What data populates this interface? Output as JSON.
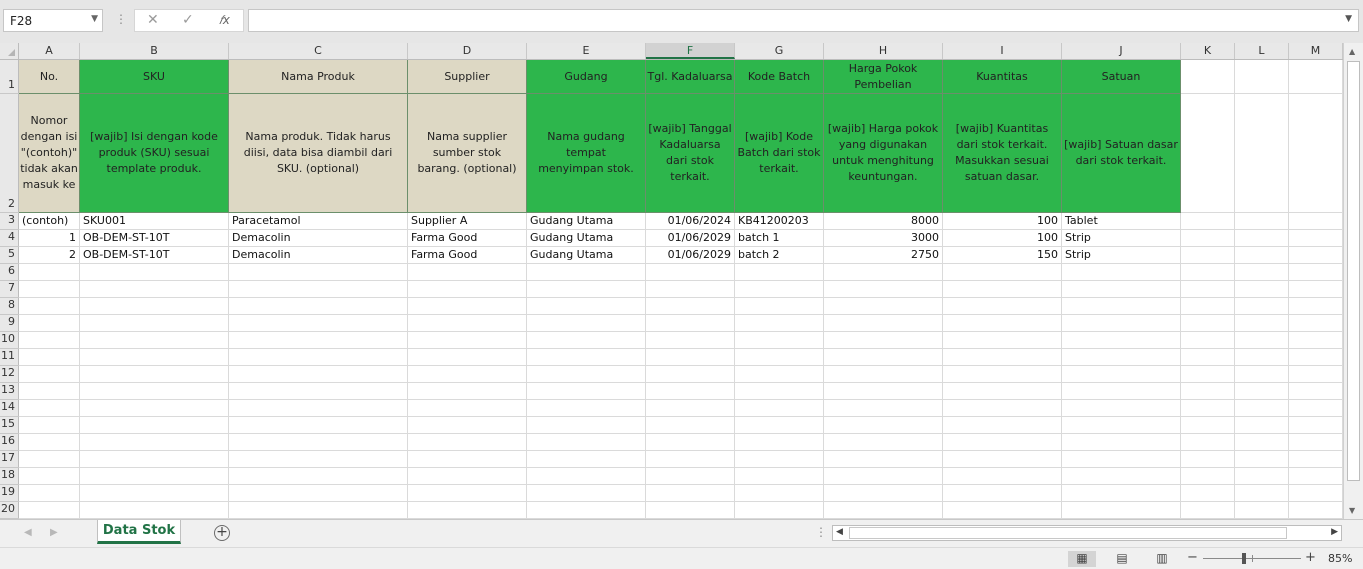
{
  "formula_bar": {
    "name_box": "F28",
    "sep": "⋮",
    "cancel_glyph": "✕",
    "enter_glyph": "✓",
    "fx_glyph": "𝑓x",
    "formula": ""
  },
  "columns": [
    "A",
    "B",
    "C",
    "D",
    "E",
    "F",
    "G",
    "H",
    "I",
    "J",
    "K",
    "L",
    "M"
  ],
  "selected_column": "F",
  "rows": [
    "1",
    "2",
    "3",
    "4",
    "5",
    "6",
    "7",
    "8",
    "9",
    "10",
    "11",
    "12",
    "13",
    "14",
    "15",
    "16",
    "17",
    "18",
    "19",
    "20"
  ],
  "header_row": {
    "no": "No.",
    "sku": "SKU",
    "nama_produk": "Nama Produk",
    "supplier": "Supplier",
    "gudang": "Gudang",
    "tgl_kadaluarsa": "Tgl. Kadaluarsa",
    "kode_batch": "Kode Batch",
    "harga_pokok": "Harga Pokok Pembelian",
    "kuantitas": "Kuantitas",
    "satuan": "Satuan"
  },
  "description_row": {
    "no": "Nomor dengan isi \"(contoh)\" tidak akan masuk ke",
    "sku": "[wajib] Isi dengan kode produk (SKU) sesuai template produk.",
    "nama_produk": "Nama produk. Tidak harus diisi, data bisa diambil dari SKU. (optional)",
    "supplier": "Nama supplier sumber stok barang. (optional)",
    "gudang": "Nama gudang tempat menyimpan stok.",
    "tgl_kadaluarsa": "[wajib] Tanggal Kadaluarsa dari stok terkait.",
    "kode_batch": "[wajib] Kode Batch dari stok terkait.",
    "harga_pokok": "[wajib] Harga pokok yang digunakan untuk menghitung keuntungan.",
    "kuantitas": "[wajib] Kuantitas dari stok terkait. Masukkan sesuai satuan dasar.",
    "satuan": "[wajib] Satuan dasar dari stok terkait."
  },
  "data_rows": [
    {
      "no": "(contoh)",
      "sku": "SKU001",
      "nama_produk": "Paracetamol",
      "supplier": "Supplier A",
      "gudang": "Gudang Utama",
      "tgl": "01/06/2024",
      "batch": "KB41200203",
      "harga": "8000",
      "qty": "100",
      "satuan": "Tablet"
    },
    {
      "no": "1",
      "sku": "OB-DEM-ST-10T",
      "nama_produk": "Demacolin",
      "supplier": "Farma Good",
      "gudang": "Gudang Utama",
      "tgl": "01/06/2029",
      "batch": "batch 1",
      "harga": "3000",
      "qty": "100",
      "satuan": "Strip"
    },
    {
      "no": "2",
      "sku": "OB-DEM-ST-10T",
      "nama_produk": "Demacolin",
      "supplier": "Farma Good",
      "gudang": "Gudang Utama",
      "tgl": "01/06/2029",
      "batch": "batch 2",
      "harga": "2750",
      "qty": "150",
      "satuan": "Strip"
    }
  ],
  "sheet_tabs": {
    "active": "Data Stok",
    "add_glyph": "+",
    "prev_glyph": "◀",
    "next_glyph": "▶",
    "dots": "⋮"
  },
  "status_bar": {
    "view_normal_glyph": "▦",
    "view_layout_glyph": "▤",
    "view_break_glyph": "▥",
    "zoom_minus": "−",
    "zoom_plus": "+",
    "zoom": "85%"
  },
  "colors": {
    "header_green": "#2db64c",
    "header_beige": "#ddd8c4",
    "accent": "#217346"
  },
  "icons": {
    "name_box_dropdown": "chevron-down-icon",
    "cancel": "close-icon",
    "enter": "check-icon",
    "function": "function-icon",
    "add_sheet": "plus-circle-icon"
  }
}
